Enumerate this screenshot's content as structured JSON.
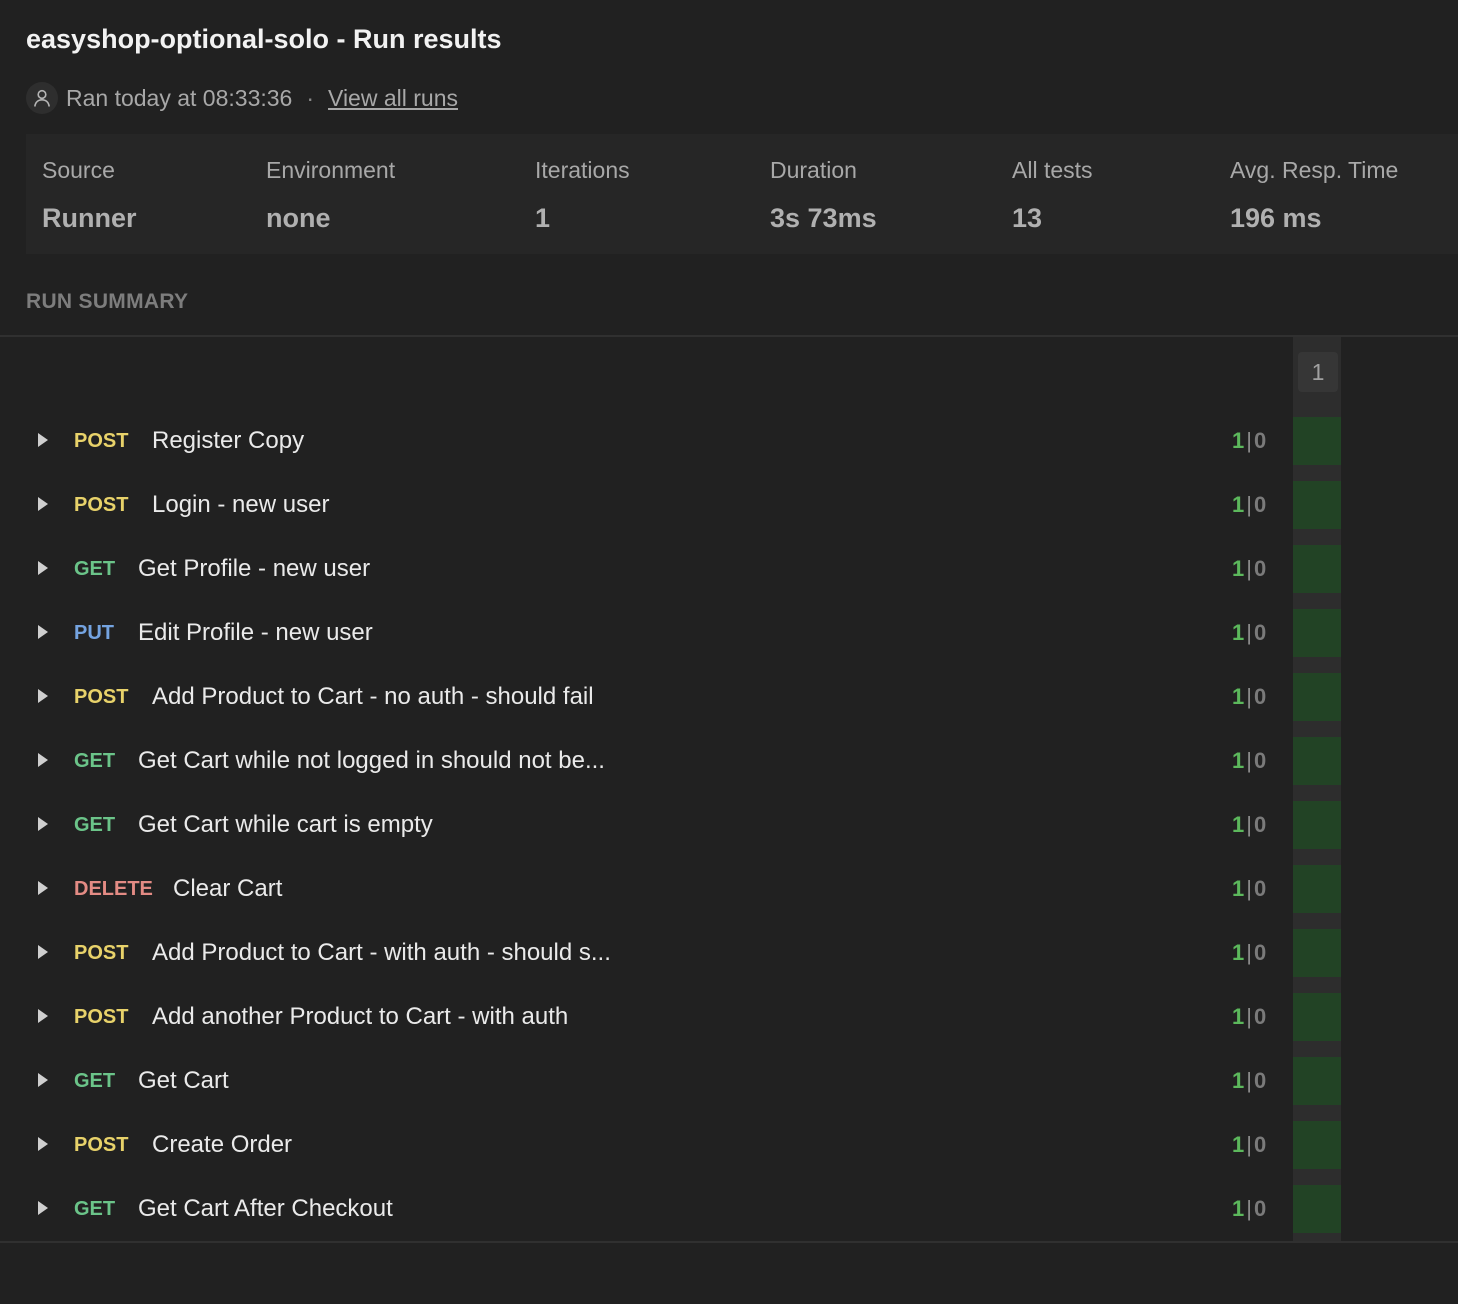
{
  "title": "easyshop-optional-solo - Run results",
  "meta": {
    "ran_text": "Ran today at 08:33:36",
    "separator": "·",
    "view_all_runs": "View all runs"
  },
  "stats": [
    {
      "label": "Source",
      "value": "Runner"
    },
    {
      "label": "Environment",
      "value": "none"
    },
    {
      "label": "Iterations",
      "value": "1"
    },
    {
      "label": "Duration",
      "value": "3s 73ms"
    },
    {
      "label": "All tests",
      "value": "13"
    },
    {
      "label": "Avg. Resp. Time",
      "value": "196 ms"
    }
  ],
  "summary": {
    "heading": "RUN SUMMARY",
    "iteration_label": "1"
  },
  "colors": {
    "POST": "#e8d26a",
    "GET": "#6bc489",
    "PUT": "#74a3e0",
    "DELETE": "#e38b84",
    "pass_cell": "#224325"
  },
  "requests": [
    {
      "method": "POST",
      "name": "Register Copy",
      "passed": "1",
      "failed": "0"
    },
    {
      "method": "POST",
      "name": "Login - new user",
      "passed": "1",
      "failed": "0"
    },
    {
      "method": "GET",
      "name": "Get Profile - new user",
      "passed": "1",
      "failed": "0"
    },
    {
      "method": "PUT",
      "name": "Edit Profile - new user",
      "passed": "1",
      "failed": "0"
    },
    {
      "method": "POST",
      "name": "Add Product to Cart - no auth - should fail",
      "passed": "1",
      "failed": "0"
    },
    {
      "method": "GET",
      "name": "Get Cart while not logged in should not be...",
      "passed": "1",
      "failed": "0"
    },
    {
      "method": "GET",
      "name": "Get Cart while cart is empty",
      "passed": "1",
      "failed": "0"
    },
    {
      "method": "DELETE",
      "name": "Clear Cart",
      "passed": "1",
      "failed": "0"
    },
    {
      "method": "POST",
      "name": "Add Product to Cart - with auth - should s...",
      "passed": "1",
      "failed": "0"
    },
    {
      "method": "POST",
      "name": "Add another Product to Cart - with auth",
      "passed": "1",
      "failed": "0"
    },
    {
      "method": "GET",
      "name": "Get Cart",
      "passed": "1",
      "failed": "0"
    },
    {
      "method": "POST",
      "name": "Create Order",
      "passed": "1",
      "failed": "0"
    },
    {
      "method": "GET",
      "name": "Get Cart After Checkout",
      "passed": "1",
      "failed": "0"
    }
  ]
}
